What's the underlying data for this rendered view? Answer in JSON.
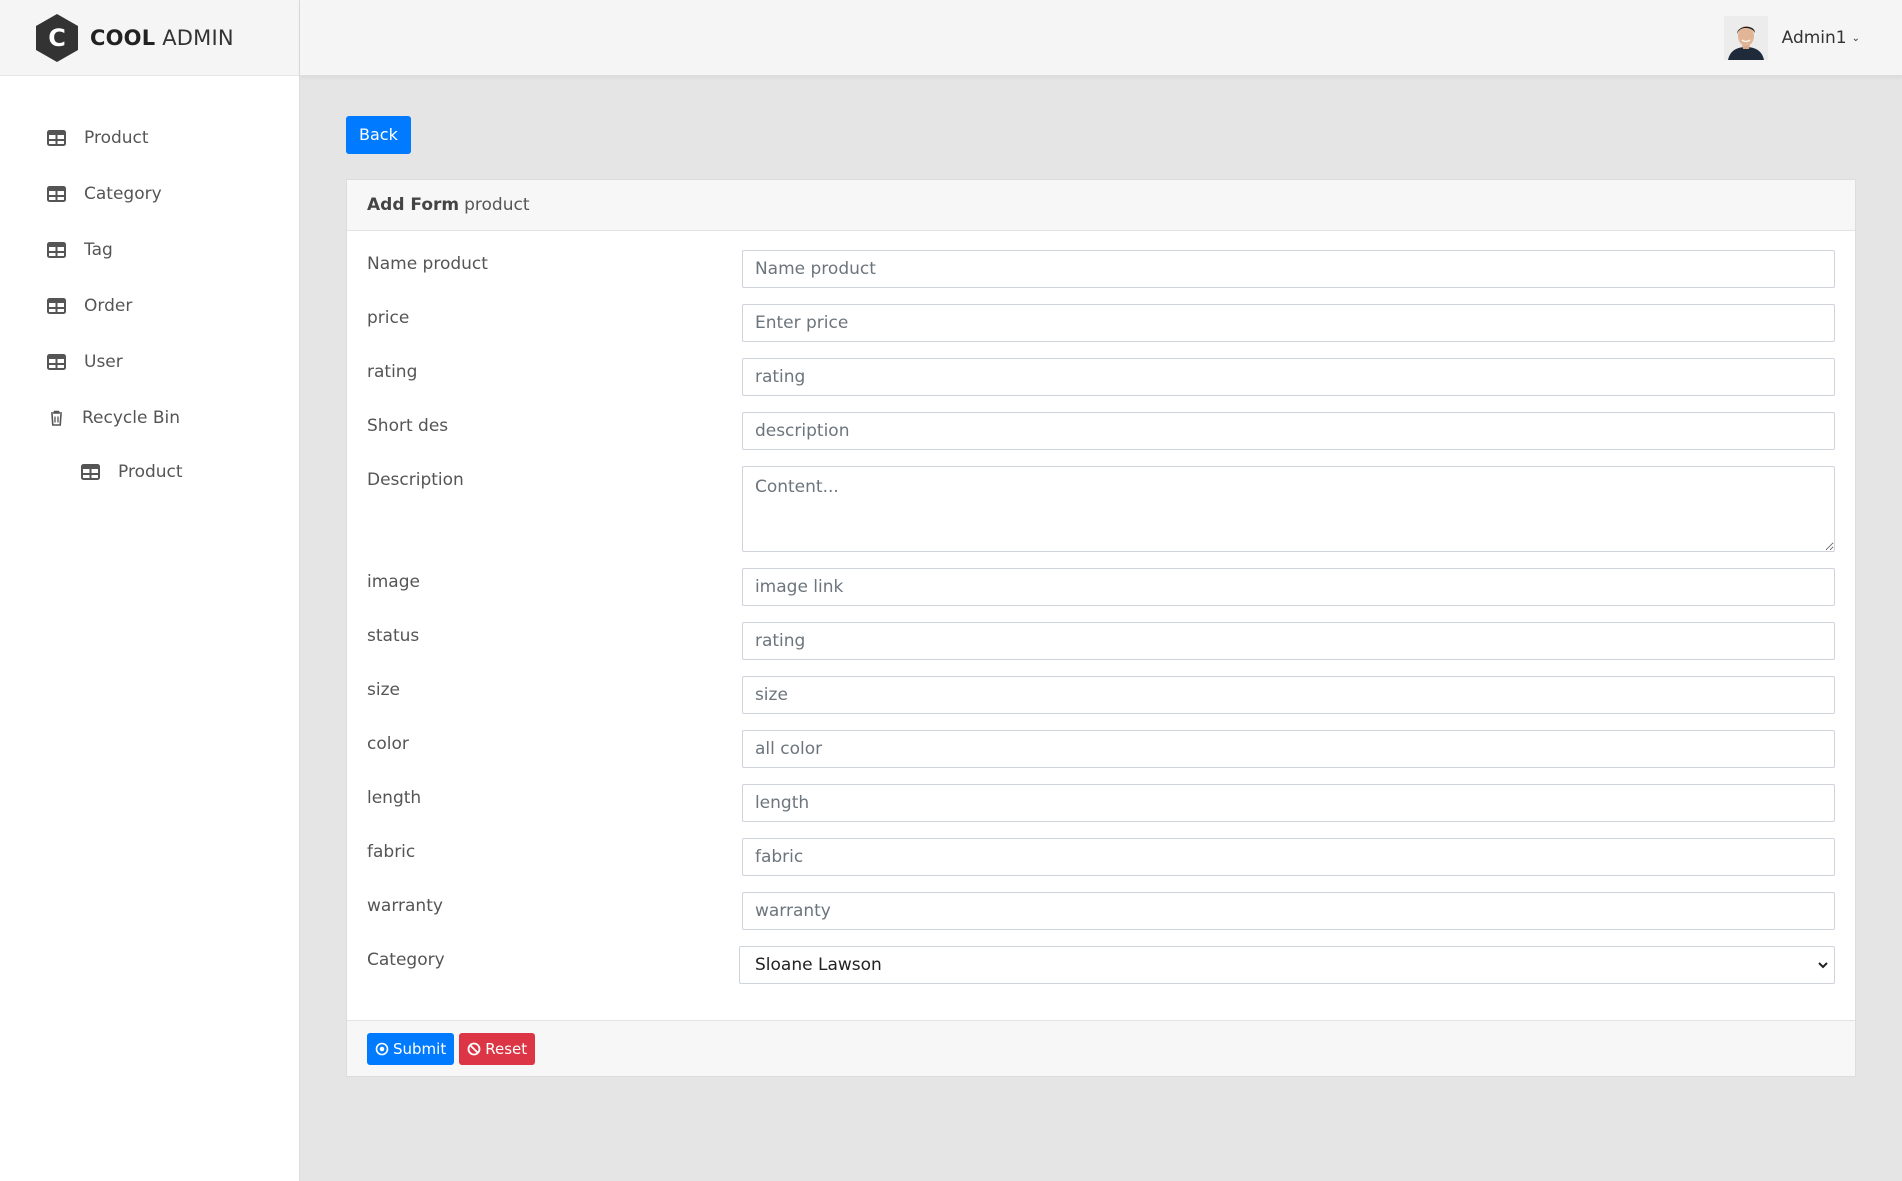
{
  "brand": {
    "bold": "COOL",
    "light": "ADMIN",
    "mark": "C"
  },
  "sidebar": {
    "items": [
      {
        "label": "Product",
        "icon": "table-icon"
      },
      {
        "label": "Category",
        "icon": "table-icon"
      },
      {
        "label": "Tag",
        "icon": "table-icon"
      },
      {
        "label": "Order",
        "icon": "table-icon"
      },
      {
        "label": "User",
        "icon": "table-icon"
      },
      {
        "label": "Recycle Bin",
        "icon": "trash-icon"
      },
      {
        "label": "Product",
        "icon": "table-icon"
      }
    ]
  },
  "header": {
    "account_name": "Admin1",
    "caret": "⌄"
  },
  "page": {
    "back_label": "Back"
  },
  "form": {
    "title_bold": "Add Form",
    "title_rest": "product",
    "fields": [
      {
        "label": "Name product",
        "placeholder": "Name product",
        "value": ""
      },
      {
        "label": "price",
        "placeholder": "Enter price",
        "value": ""
      },
      {
        "label": "rating",
        "placeholder": "rating",
        "value": ""
      },
      {
        "label": "Short des",
        "placeholder": "description",
        "value": ""
      },
      {
        "label": "Description",
        "placeholder": "Content...",
        "value": ""
      },
      {
        "label": "image",
        "placeholder": "image link",
        "value": ""
      },
      {
        "label": "status",
        "placeholder": "rating",
        "value": ""
      },
      {
        "label": "size",
        "placeholder": "size",
        "value": ""
      },
      {
        "label": "color",
        "placeholder": "all color",
        "value": ""
      },
      {
        "label": "length",
        "placeholder": "length",
        "value": ""
      },
      {
        "label": "fabric",
        "placeholder": "fabric",
        "value": ""
      },
      {
        "label": "warranty",
        "placeholder": "warranty",
        "value": ""
      }
    ],
    "category": {
      "label": "Category",
      "selected": "Sloane Lawson"
    },
    "submit_label": "Submit",
    "reset_label": "Reset"
  },
  "colors": {
    "primary": "#007bff",
    "danger": "#dc3545",
    "logo_hex": "#333333"
  }
}
